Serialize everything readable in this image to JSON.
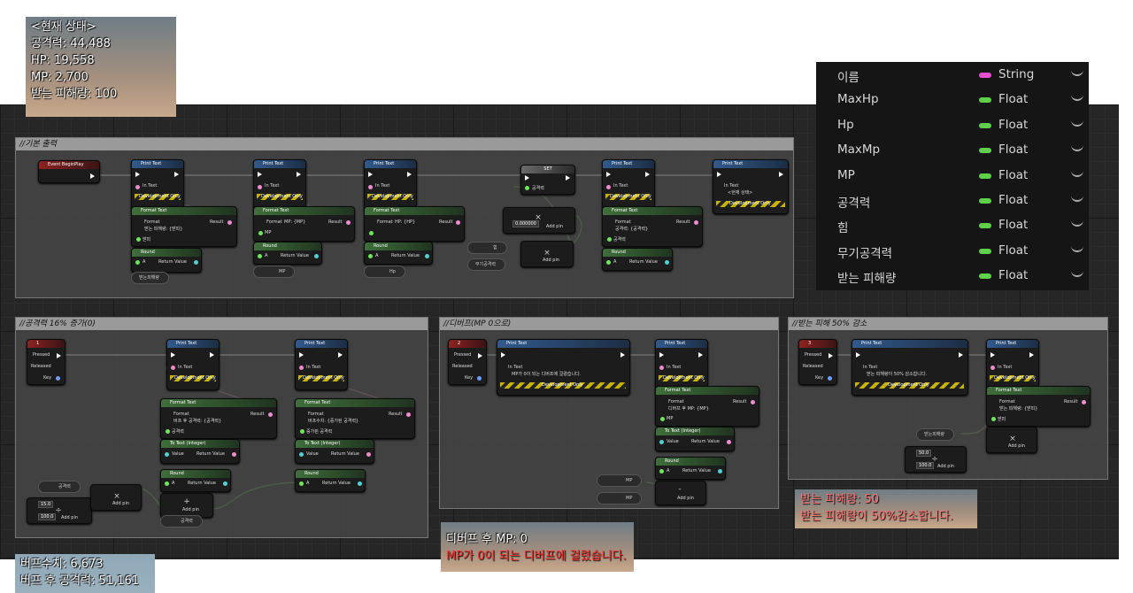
{
  "status_overlay": {
    "title": "<현재 상태>",
    "attack": "공격력: 44,488",
    "hp": "HP: 19,558",
    "mp": "MP: 2,700",
    "damage_taken": "받는 피해량: 100"
  },
  "variables": [
    {
      "name": "이름",
      "type": "String",
      "color": "#e84fd0"
    },
    {
      "name": "MaxHp",
      "type": "Float",
      "color": "#5fd04a"
    },
    {
      "name": "Hp",
      "type": "Float",
      "color": "#5fd04a"
    },
    {
      "name": "MaxMp",
      "type": "Float",
      "color": "#5fd04a"
    },
    {
      "name": "MP",
      "type": "Float",
      "color": "#5fd04a"
    },
    {
      "name": "공격력",
      "type": "Float",
      "color": "#5fd04a"
    },
    {
      "name": "힘",
      "type": "Float",
      "color": "#5fd04a"
    },
    {
      "name": "무기공격력",
      "type": "Float",
      "color": "#5fd04a"
    },
    {
      "name": "받는 피해량",
      "type": "Float",
      "color": "#5fd04a"
    }
  ],
  "comments": {
    "basic": "//기본 출력",
    "buff": "//공격력 16% 증가(0)",
    "debuff": "//디버프(MP 0으로)",
    "damage": "//받는 피해 50% 감소"
  },
  "nodes": {
    "event_begin_play": "Event BeginPlay",
    "print_text": "Print Text",
    "format_text": "Format Text",
    "to_text_integer": "To Text (Integer)",
    "round": "Round",
    "set": "SET",
    "in_text": "In Text",
    "dev_only": "Development Only",
    "format": "Format",
    "result": "Result",
    "return_value": "Return Value",
    "value": "Value",
    "a": "A",
    "add_pin": "Add pin",
    "pressed": "Pressed",
    "released": "Released",
    "key": "Key",
    "key1": "1",
    "key2": "2",
    "key3": "3",
    "fmt_damage": "받는 피해량: {받피}",
    "fmt_mp": "MP: {MP}",
    "fmt_hp": "HP: {HP}",
    "fmt_atk": "공격력: {공격력}",
    "fmt_buff_atk": "버프 후 공격력: {공격력}",
    "fmt_buff_val": "버프수치: {증가된 공격력}",
    "fmt_debuff": "디버프 후 MP: {MP}",
    "fmt_damage2": "받는 피해량: {받피}",
    "in_text_status": "<현재 상태>",
    "in_text_debuff": "MP가 0이 되는 디버프에 걸렸습니다.",
    "in_text_damage": "받는 피해량이 50% 감소합니다.",
    "var_damage": "받는피해량",
    "var_mp": "MP",
    "var_hp": "Hp",
    "var_str": "힘",
    "var_weapon": "무기공격력",
    "var_atk": "공격력",
    "var_inc_atk": "증가된 공격력",
    "pin_damage": "받피",
    "pin_mp": "MP",
    "pin_atk": "공격력",
    "pin_inc": "증가된 공격력",
    "num_001": "0.000000",
    "num_15": "15.0",
    "num_100": "100.0",
    "num_50": "50.0"
  },
  "debuff_overlay": {
    "line1": "디버프 후 MP: 0",
    "line2": "MP가 0이 되는 디버프에 걸렸습니다."
  },
  "damage_overlay": {
    "line1": "받는 피해량: 50",
    "line2": "받는 피해량이 50%감소합니다."
  },
  "buff_overlay": {
    "line1": "버프수치: 6,673",
    "line2": "버프 후 공격력: 51,161"
  }
}
